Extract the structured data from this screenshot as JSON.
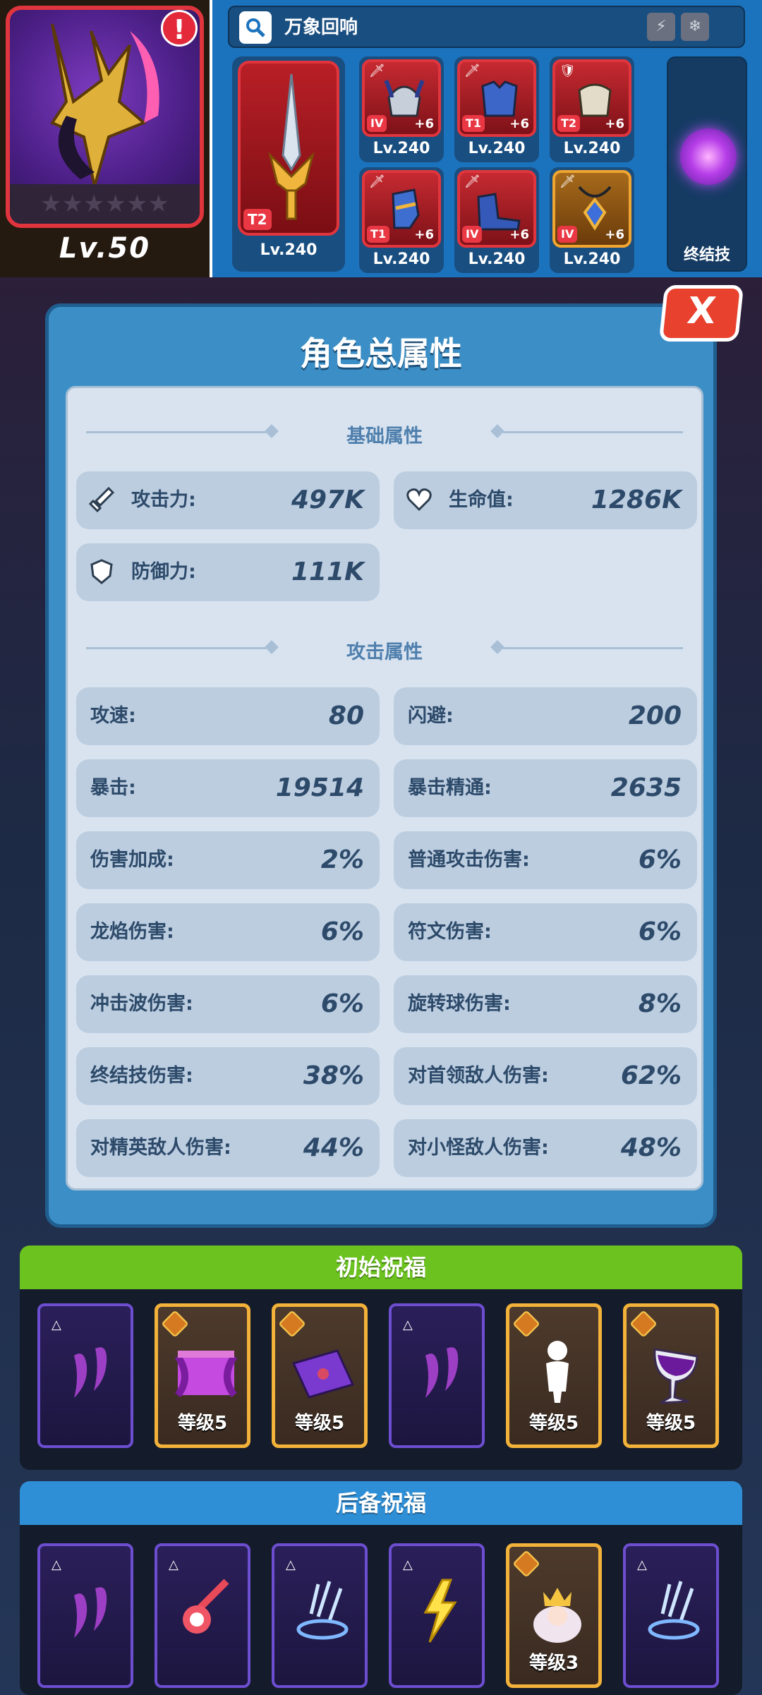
{
  "hero": {
    "level": "Lv.50",
    "alert": "!",
    "stars": "★★★★★★"
  },
  "gear": {
    "search_label": "万象回响",
    "weapon": {
      "tier": "T2",
      "level": "Lv.240"
    },
    "slots": [
      {
        "tier": "IV",
        "plus": "+6",
        "level": "Lv.240"
      },
      {
        "tier": "T1",
        "plus": "+6",
        "level": "Lv.240"
      },
      {
        "tier": "T2",
        "plus": "+6",
        "level": "Lv.240"
      },
      {
        "tier": "T1",
        "plus": "+6",
        "level": "Lv.240"
      },
      {
        "tier": "IV",
        "plus": "+6",
        "level": "Lv.240"
      },
      {
        "tier": "IV",
        "plus": "+6",
        "level": "Lv.240"
      }
    ],
    "ultimate_label": "终结技"
  },
  "panel": {
    "title": "角色总属性",
    "close": "X",
    "basic_header": "基础属性",
    "basic": [
      {
        "name": "攻击力:",
        "value": "497K",
        "icon": "sword-icon"
      },
      {
        "name": "生命值:",
        "value": "1286K",
        "icon": "heart-icon"
      },
      {
        "name": "防御力:",
        "value": "111K",
        "icon": "shield-icon"
      }
    ],
    "attack_header": "攻击属性",
    "attack": [
      {
        "name": "攻速:",
        "value": "80"
      },
      {
        "name": "闪避:",
        "value": "200"
      },
      {
        "name": "暴击:",
        "value": "19514"
      },
      {
        "name": "暴击精通:",
        "value": "2635"
      },
      {
        "name": "伤害加成:",
        "value": "2%"
      },
      {
        "name": "普通攻击伤害:",
        "value": "6%"
      },
      {
        "name": "龙焰伤害:",
        "value": "6%"
      },
      {
        "name": "符文伤害:",
        "value": "6%"
      },
      {
        "name": "冲击波伤害:",
        "value": "6%"
      },
      {
        "name": "旋转球伤害:",
        "value": "8%"
      },
      {
        "name": "终结技伤害:",
        "value": "38%"
      },
      {
        "name": "对首领敌人伤害:",
        "value": "62%"
      },
      {
        "name": "对精英敌人伤害:",
        "value": "44%"
      },
      {
        "name": "对小怪敌人伤害:",
        "value": "48%"
      }
    ]
  },
  "initial_blessings": {
    "title": "初始祝福",
    "header_color": "#6cc31f",
    "cards": [
      {
        "type": "purple",
        "icon": "ghost-icon",
        "level": ""
      },
      {
        "type": "gold",
        "icon": "stage-icon",
        "level": "等级5"
      },
      {
        "type": "gold",
        "icon": "envelope-icon",
        "level": "等级5"
      },
      {
        "type": "purple",
        "icon": "ghost-icon",
        "level": ""
      },
      {
        "type": "gold",
        "icon": "figure-icon",
        "level": "等级5"
      },
      {
        "type": "gold",
        "icon": "goblet-icon",
        "level": "等级5"
      }
    ]
  },
  "backup_blessings": {
    "title": "后备祝福",
    "header_color": "#2f8fd6",
    "cards": [
      {
        "type": "purple",
        "icon": "ghost-icon",
        "level": ""
      },
      {
        "type": "purple",
        "icon": "meteor-icon",
        "level": ""
      },
      {
        "type": "purple",
        "icon": "shockwave-icon",
        "level": ""
      },
      {
        "type": "purple",
        "icon": "lightning-icon",
        "level": ""
      },
      {
        "type": "gold",
        "icon": "crown-icon",
        "level": "等级3"
      },
      {
        "type": "purple",
        "icon": "shockwave-icon",
        "level": ""
      }
    ]
  }
}
